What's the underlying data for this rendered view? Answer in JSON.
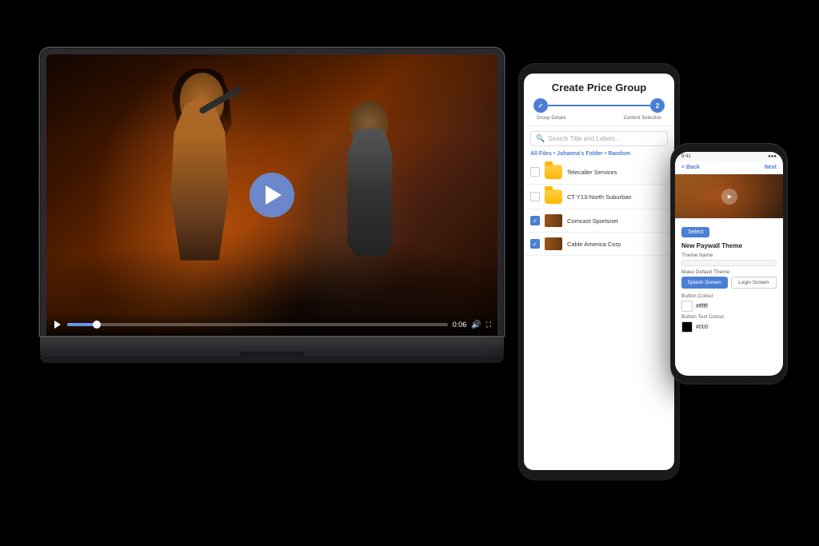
{
  "scene": {
    "background": "#000000"
  },
  "laptop": {
    "video": {
      "progress_percent": 8,
      "time": "0:06",
      "play_button_label": "Play"
    }
  },
  "tablet": {
    "title": "Create Price Group",
    "steps": {
      "step1_label": "Group Details",
      "step2_label": "Content Selection"
    },
    "search_placeholder": "Search Title and Labels...",
    "breadcrumb": "All Files • Johanna's Folder • Random",
    "files": [
      {
        "name": "Telecaller Services",
        "type": "folder",
        "checked": false
      },
      {
        "name": "CT Y13-North Suburban",
        "type": "folder",
        "checked": false
      },
      {
        "name": "Comcast Sportsnet",
        "type": "video",
        "checked": true
      },
      {
        "name": "Cable America Corp",
        "type": "video",
        "checked": true
      }
    ]
  },
  "phone": {
    "status": {
      "time": "9:41",
      "signal": "●●●",
      "battery": "▮▮▮"
    },
    "top_bar": {
      "back_label": "< Back",
      "next_label": "Next"
    },
    "section_title": "New Paywall Theme",
    "theme_name_label": "Theme Name",
    "theme_name_value": "",
    "default_theme_label": "Make Default Theme",
    "splash_screen_label": "Splash Screen",
    "login_screen_label": "Login Screen",
    "button_colour_label": "Button Colour",
    "button_colour_value": "#ffffff",
    "button_text_colour_label": "Button Text Colour",
    "button_text_colour_value": "#000"
  }
}
